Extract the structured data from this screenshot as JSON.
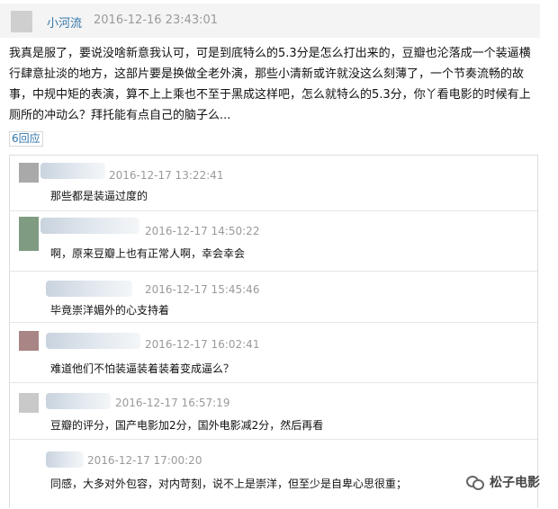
{
  "main_comment": {
    "username": "小河流",
    "timestamp": "2016-12-16 23:43:01",
    "lines": [
      "我真是服了，要说没啥新意我认可，可是到底特么的5.3分是怎么打出来的，豆瓣也沦落成一个装逼横",
      "行肆意扯淡的地方，这部片要是换做全老外演，那些小清新或许就没这么刻薄了，一个节奏流畅的故",
      "事，中规中矩的表演，算不上上乘也不至于黑成这样吧，怎么就特么的5.3分，你丫看电影的时候有上",
      "厕所的冲动么？拜托能有点自己的脑子么..."
    ],
    "reply_count": "6回应"
  },
  "replies": [
    {
      "timestamp": "2016-12-17 13:22:41",
      "text": "那些都是装逼过度的",
      "avatar_color": "grey"
    },
    {
      "timestamp": "2016-12-17 14:50:22",
      "text": "啊，原来豆瓣上也有正常人啊，幸会幸会",
      "avatar_color": "green"
    },
    {
      "timestamp": "2016-12-17 15:45:46",
      "text": "毕竟崇洋媚外的心支持着",
      "avatar_color": "none"
    },
    {
      "timestamp": "2016-12-17 16:02:41",
      "text": "难道他们不怕装逼装着装着变成逼么？",
      "avatar_color": "rose"
    },
    {
      "timestamp": "2016-12-17 16:57:19",
      "text": "豆瓣的评分，国产电影加2分，国外电影减2分，然后再看",
      "avatar_color": "light"
    },
    {
      "timestamp": "2016-12-17 17:00:20",
      "text": "同感，大多对外包容，对内苛刻，说不上是崇洋，但至少是自卑心思很重；",
      "avatar_color": "none"
    }
  ],
  "watermark": {
    "icon": "wechat-icon",
    "text": "松子电影"
  }
}
